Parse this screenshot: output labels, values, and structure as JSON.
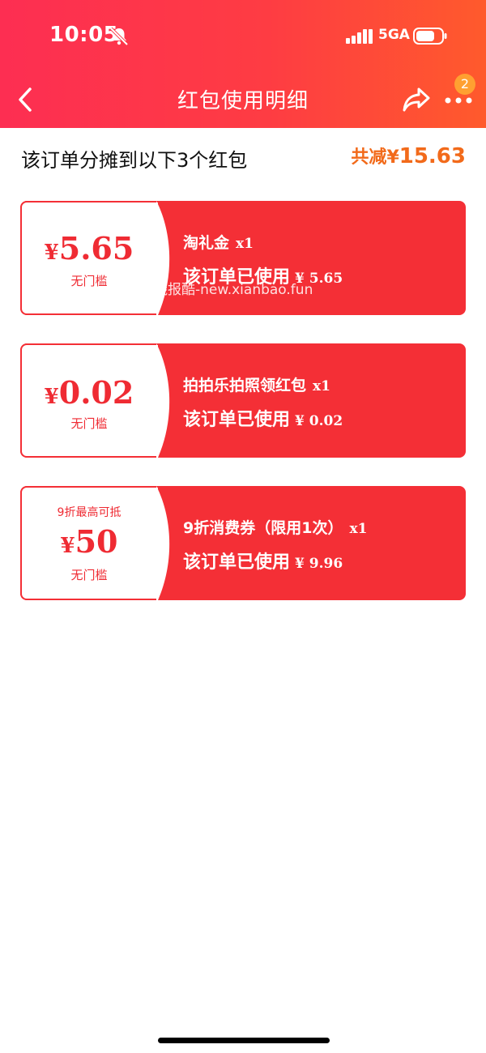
{
  "status_bar": {
    "time": "10:05",
    "network": "5GA",
    "icons": [
      "bell-muted-icon",
      "signal-icon",
      "battery-icon"
    ]
  },
  "nav": {
    "title": "红包使用明细",
    "badge_count": "2",
    "icons": [
      "back-icon",
      "share-icon",
      "more-icon"
    ]
  },
  "summary": {
    "text": "该订单分摊到以下3个红包",
    "total_label": "共减",
    "total_currency": "¥",
    "total_value": "15.63"
  },
  "cards": [
    {
      "currency": "¥",
      "amount": "5.65",
      "threshold": "无门槛",
      "name": "淘礼金",
      "qty": "x1",
      "used_label": "该订单已使用",
      "used_amount": "¥ 5.65"
    },
    {
      "currency": "¥",
      "amount": "0.02",
      "threshold": "无门槛",
      "name": "拍拍乐拍照领红包",
      "qty": "x1",
      "used_label": "该订单已使用",
      "used_amount": "¥ 0.02"
    },
    {
      "discount_cap": "9折最高可抵",
      "currency": "¥",
      "amount": "50",
      "threshold": "无门槛",
      "name": "9折消费券（限用1次）",
      "qty": "x1",
      "used_label": "该订单已使用",
      "used_amount": "¥ 9.96"
    }
  ],
  "watermark": "线报酷-new.xianbao.fun",
  "colors": {
    "header_start": "#fd2e52",
    "header_end": "#ff5a2c",
    "card_red": "#f42f36",
    "total_orange": "#f26a1a",
    "badge_orange": "#ffa031"
  }
}
